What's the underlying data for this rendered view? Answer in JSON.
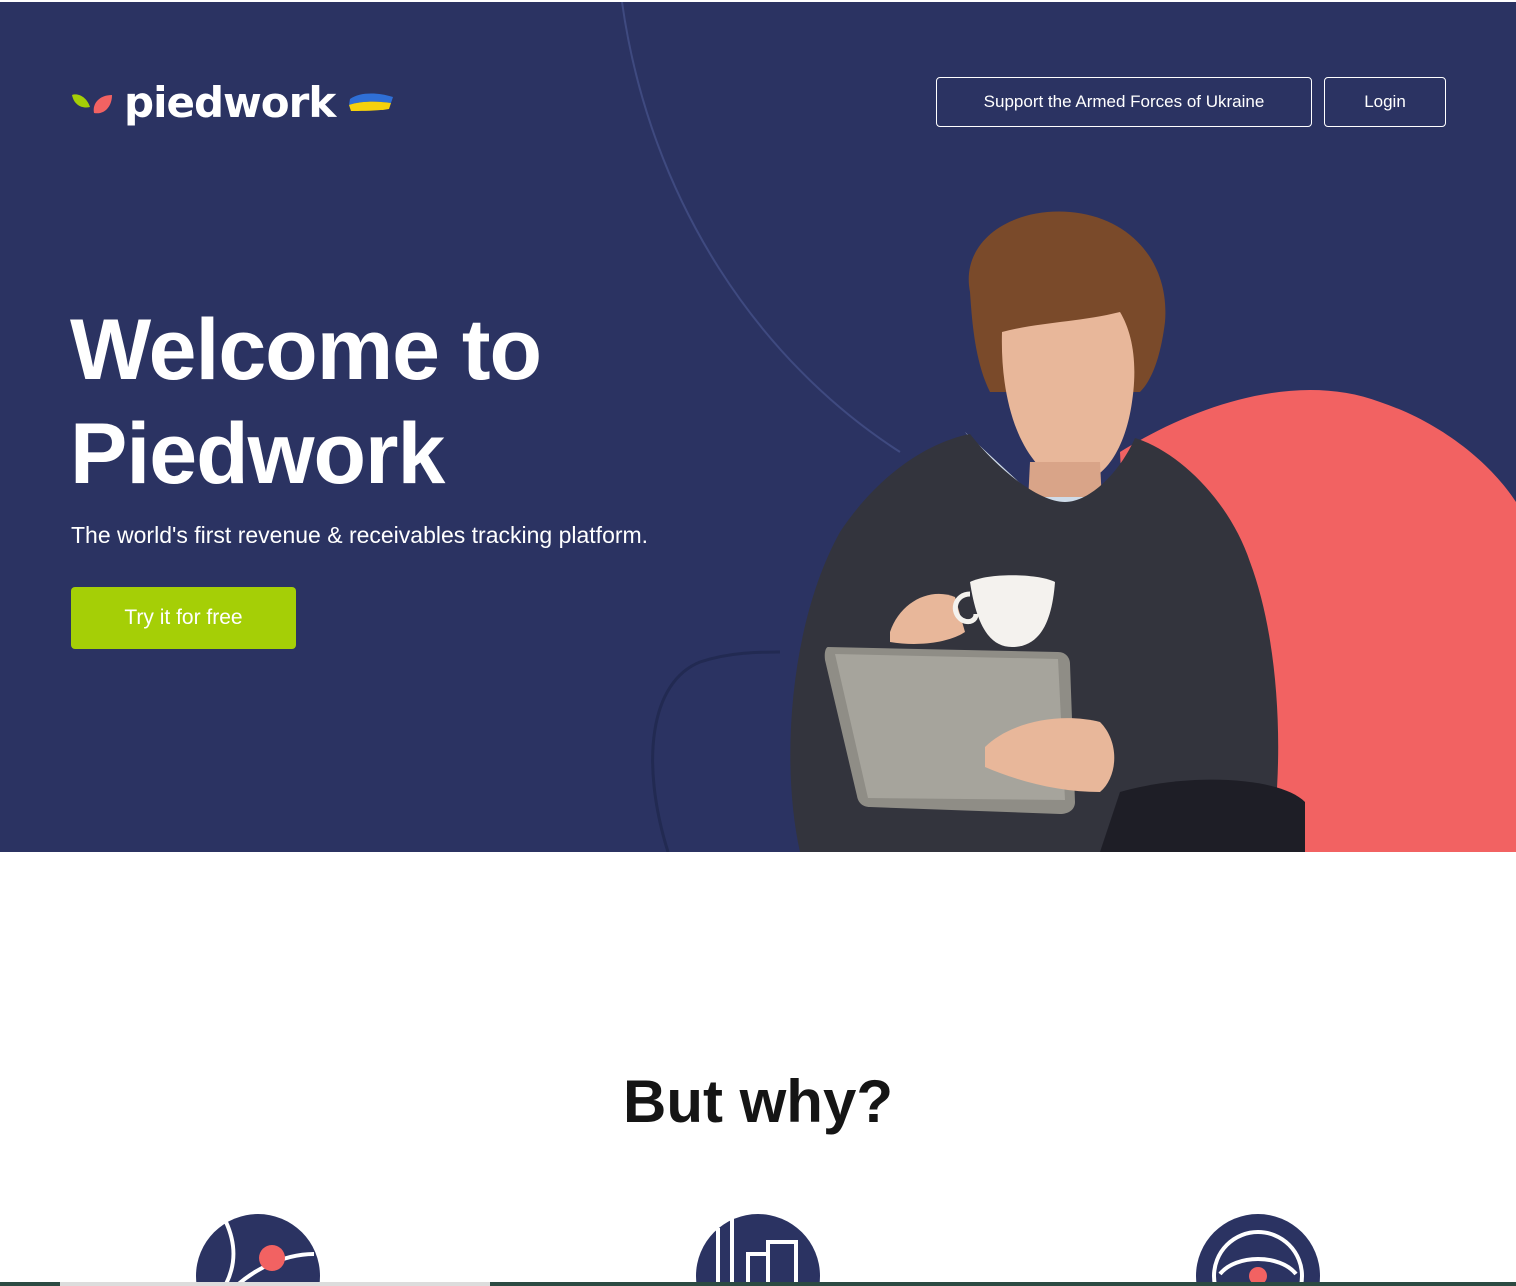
{
  "header": {
    "logo_text": "piedwork",
    "support_button": "Support the Armed Forces of Ukraine",
    "login_button": "Login"
  },
  "hero": {
    "title_line1": "Welcome to",
    "title_line2": "Piedwork",
    "subtitle": "The world's first revenue & receivables tracking platform.",
    "cta_label": "Try it for free"
  },
  "why": {
    "title": "But why?"
  },
  "colors": {
    "hero_bg": "#2b3362",
    "accent_green": "#a5cf06",
    "accent_coral": "#f26262",
    "flag_blue": "#2f6fd6",
    "flag_yellow": "#f5d10c"
  },
  "icons": {
    "logo": "piedwork-leaves-logo-icon",
    "flag": "ukraine-flag-icon",
    "feature_1": "globe-pin-icon",
    "feature_2": "bar-columns-icon",
    "feature_3": "network-circle-icon"
  }
}
